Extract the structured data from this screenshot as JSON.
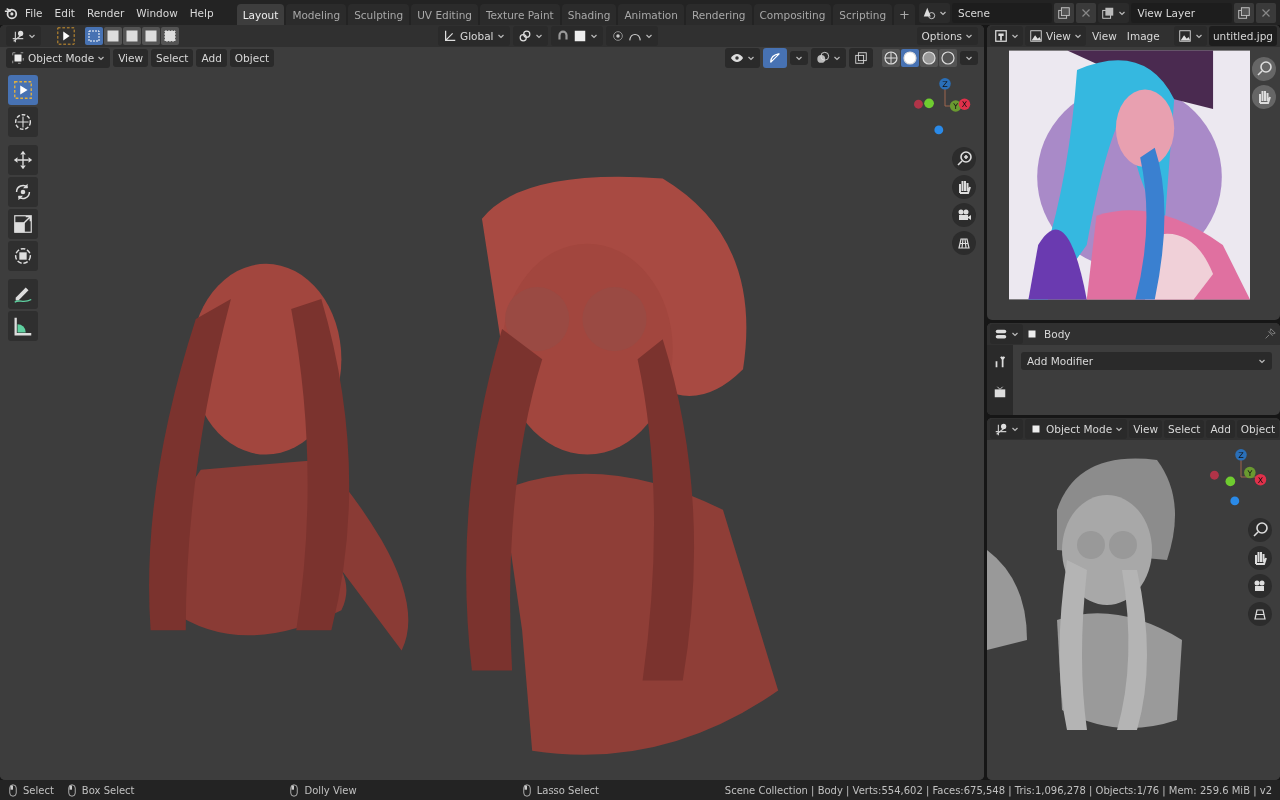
{
  "topbar": {
    "menus": [
      "File",
      "Edit",
      "Render",
      "Window",
      "Help"
    ],
    "tabs": [
      {
        "label": "Layout",
        "selected": true
      },
      {
        "label": "Modeling",
        "selected": false
      },
      {
        "label": "Sculpting",
        "selected": false
      },
      {
        "label": "UV Editing",
        "selected": false
      },
      {
        "label": "Texture Paint",
        "selected": false
      },
      {
        "label": "Shading",
        "selected": false
      },
      {
        "label": "Animation",
        "selected": false
      },
      {
        "label": "Rendering",
        "selected": false
      },
      {
        "label": "Compositing",
        "selected": false
      },
      {
        "label": "Scripting",
        "selected": false
      }
    ],
    "add_tab": "+",
    "scene": "Scene",
    "view_layer": "View Layer"
  },
  "viewport": {
    "tool_header": {
      "select_modes": [
        {
          "selected": true
        },
        {
          "selected": false
        },
        {
          "selected": false
        },
        {
          "selected": false
        },
        {
          "selected": false
        }
      ],
      "orientation": "Global",
      "options": "Options"
    },
    "header": {
      "mode": "Object Mode",
      "menus": [
        "View",
        "Select",
        "Add",
        "Object"
      ],
      "gizmos_on": true,
      "shading": [
        {
          "selected": false
        },
        {
          "selected": true
        },
        {
          "selected": false
        },
        {
          "selected": false
        }
      ]
    },
    "tools": [
      {
        "kind": "select",
        "selected": true
      },
      {
        "kind": "cursor",
        "selected": false
      },
      {
        "kind": "move",
        "selected": false
      },
      {
        "kind": "rotate",
        "selected": false
      },
      {
        "kind": "scale",
        "selected": false
      },
      {
        "kind": "transform",
        "selected": false
      },
      {
        "kind": "annotate",
        "selected": false
      },
      {
        "kind": "measure",
        "selected": false
      }
    ],
    "gizmo": {
      "z": "Z",
      "y": "Y",
      "x": "X"
    }
  },
  "image_editor": {
    "view_mode": "View",
    "menus": [
      "View",
      "Image"
    ],
    "image": "untitled.jpg"
  },
  "properties": {
    "object": "Body",
    "add_modifier": "Add Modifier"
  },
  "preview_viewport": {
    "mode": "Object Mode",
    "menus": [
      "View",
      "Select",
      "Add",
      "Object"
    ],
    "gizmo": {
      "z": "Z",
      "y": "Y",
      "x": "X"
    }
  },
  "status_bar": {
    "hints": [
      "Select",
      "Box Select",
      "Dolly View",
      "Lasso Select"
    ],
    "stats": "Scene Collection | Body | Verts:554,602 | Faces:675,548 | Tris:1,096,278 | Objects:1/76 | Mem: 259.6 MiB | v2"
  }
}
